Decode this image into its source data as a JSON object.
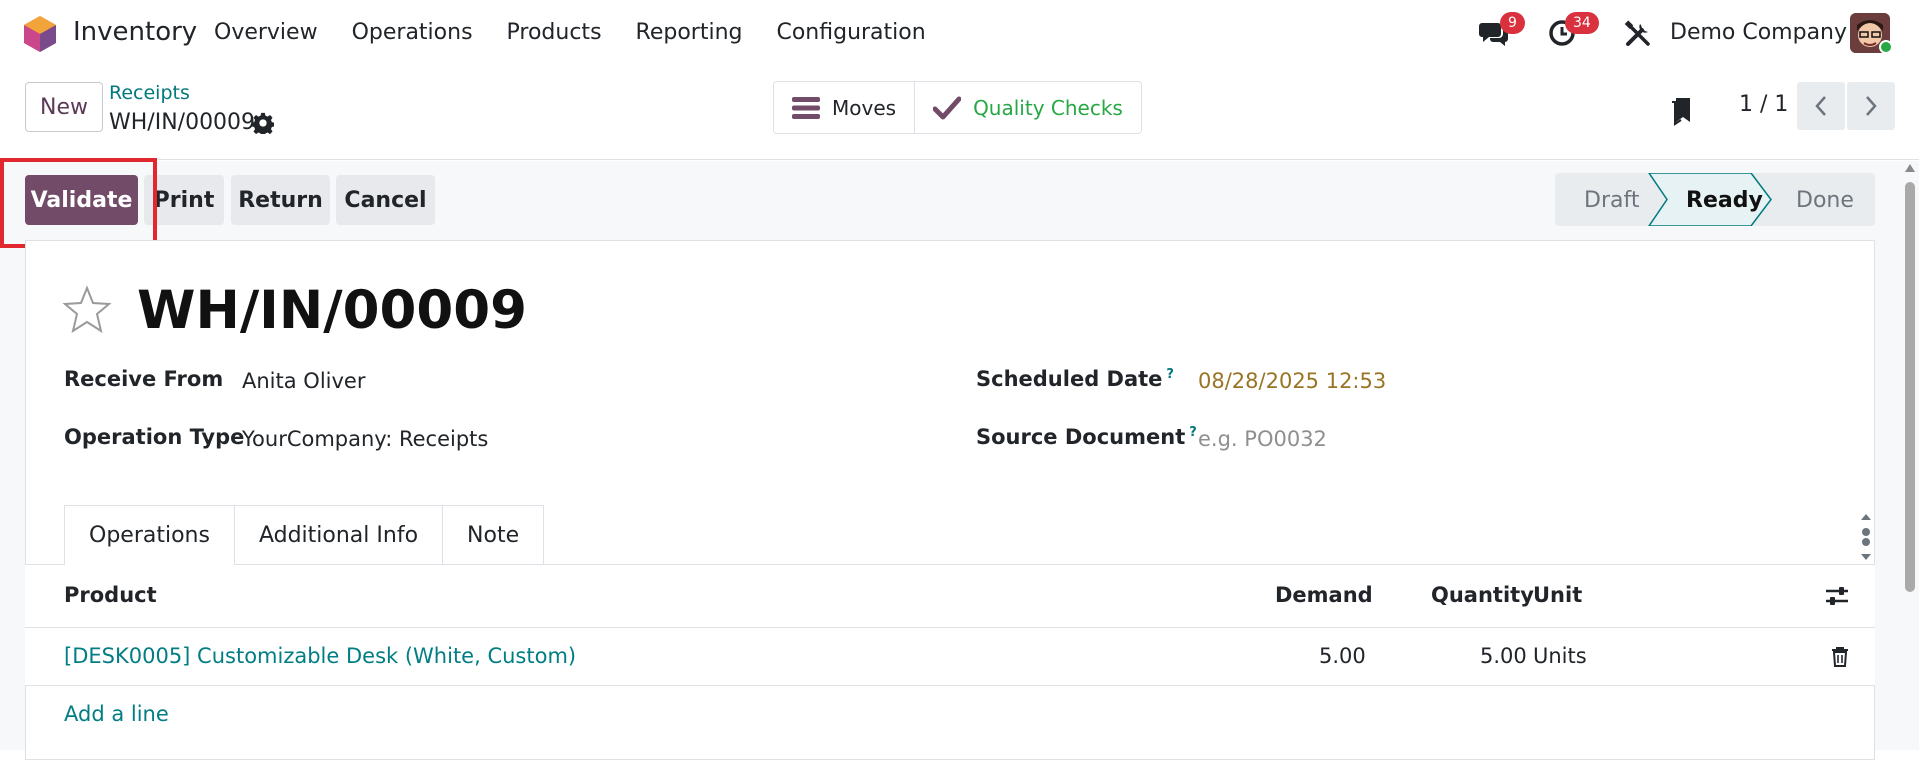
{
  "navbar": {
    "app_name": "Inventory",
    "menu": [
      "Overview",
      "Operations",
      "Products",
      "Reporting",
      "Configuration"
    ],
    "messages_badge": "9",
    "activities_badge": "34",
    "company": "Demo Company"
  },
  "control_panel": {
    "new_label": "New",
    "breadcrumb": "Receipts",
    "record_name": "WH/IN/00009",
    "smart_buttons": {
      "moves_label": "Moves",
      "quality_checks_label": "Quality Checks"
    },
    "pager": "1 / 1"
  },
  "statusbar": {
    "buttons": {
      "validate": "Validate",
      "print": "Print",
      "return": "Return",
      "cancel": "Cancel"
    },
    "stages": [
      "Draft",
      "Ready",
      "Done"
    ],
    "active_stage": "Ready"
  },
  "form": {
    "title": "WH/IN/00009",
    "receive_from_label": "Receive From",
    "receive_from_value": "Anita Oliver",
    "operation_type_label": "Operation Type",
    "operation_type_value": "YourCompany: Receipts",
    "scheduled_date_label": "Scheduled Date",
    "scheduled_date_value": "08/28/2025 12:53",
    "source_document_label": "Source Document",
    "source_document_placeholder": "e.g. PO0032",
    "help_mark": "?"
  },
  "tabs": [
    "Operations",
    "Additional Info",
    "Note"
  ],
  "active_tab": "Operations",
  "table": {
    "columns": {
      "product": "Product",
      "demand": "Demand",
      "quantity": "Quantity",
      "unit": "Unit"
    },
    "rows": [
      {
        "product": "[DESK0005] Customizable Desk (White, Custom)",
        "demand": "5.00",
        "quantity": "5.00",
        "unit": "Units"
      }
    ],
    "add_line": "Add a line"
  },
  "colors": {
    "primary": "#714b67",
    "link": "#017e84",
    "highlight_box": "#e0282e",
    "date": "#9a7425"
  }
}
